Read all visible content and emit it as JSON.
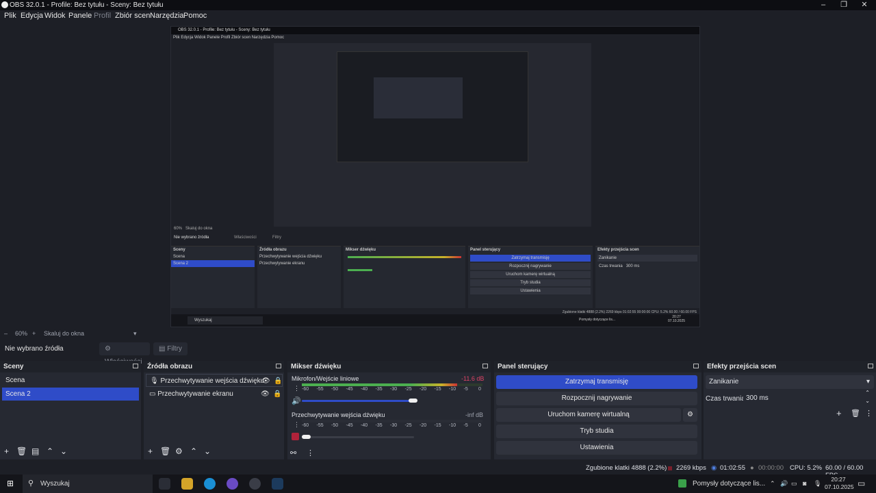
{
  "window": {
    "title": "OBS 32.0.1 - Profile: Bez tytułu - Sceny: Bez tytułu",
    "minimize": "–",
    "maximize": "❐",
    "close": "✕"
  },
  "menu": {
    "items": [
      "Plik",
      "Edycja",
      "Widok",
      "Panele",
      "Profil",
      "Zbiór scen",
      "Narzędzia",
      "Pomoc"
    ]
  },
  "preview": {
    "title": "OBS 32.0.1 - Profile: Bez tytułu - Sceny: Bez tytułu",
    "menu": "Plik  Edycja  Widok  Panele  Profil  Zbiór scen  Narzędzia  Pomoc",
    "zoom": "60%",
    "scale": "Skaluj do okna",
    "no_source": "Nie wybrano źródła",
    "props": "Właściwości",
    "filters": "Filtry",
    "scenes_title": "Sceny",
    "scene1": "Scena",
    "scene2": "Scena 2",
    "sources_title": "Źródła obrazu",
    "source1": "Przechwytywanie wejścia dźwięku",
    "source2": "Przechwytywanie ekranu",
    "mixer_title": "Mikser dźwięku",
    "controls_title": "Panel sterujący",
    "trans_title": "Efekty przejścia scen",
    "btn1": "Zatrzymaj transmisję",
    "btn2": "Rozpocznij nagrywanie",
    "btn3": "Uruchom kamerę wirtualną",
    "btn4": "Tryb studia",
    "btn5": "Ustawienia",
    "fade": "Zanikanie",
    "duration_label": "Czas trwania",
    "duration": "300 ms",
    "task_search": "Wyszukaj",
    "stats": "Zgubione klatki 4888 (2.2%)   2269 kbps   01:02:55   00:00:00   CPU: 5.2%   60.00 / 60.00 FPS",
    "clock_time": "20:27",
    "clock_date": "07.10.2025",
    "tray_text": "Pomysły dotyczące lis..."
  },
  "zoombar": {
    "zoom": "60%",
    "scale_mode": "Skaluj do okna"
  },
  "source_bar": {
    "no_source": "Nie wybrano źródła",
    "properties": "Właściwości",
    "filters": "Filtry"
  },
  "scenes": {
    "title": "Sceny",
    "items": [
      {
        "label": "Scena"
      },
      {
        "label": "Scena 2"
      }
    ]
  },
  "sources": {
    "title": "Źródła obrazu",
    "items": [
      {
        "label": "Przechwytywanie wejścia dźwięku"
      },
      {
        "label": "Przechwytywanie ekranu"
      }
    ]
  },
  "mixer": {
    "title": "Mikser dźwięku",
    "channels": [
      {
        "name": "Mikrofon/Wejście liniowe",
        "level": "-11.6 dB",
        "volume_fraction": 1.0
      },
      {
        "name": "Przechwytywanie wejścia dźwięku",
        "level": "-inf dB",
        "volume_fraction": 0.0
      }
    ],
    "scale": [
      "-60",
      "-55",
      "-50",
      "-45",
      "-40",
      "-35",
      "-30",
      "-25",
      "-20",
      "-15",
      "-10",
      "-5",
      "0"
    ]
  },
  "controls": {
    "title": "Panel sterujący",
    "stop_stream": "Zatrzymaj transmisję",
    "start_record": "Rozpocznij nagrywanie",
    "virtual_cam": "Uruchom kamerę wirtualną",
    "studio_mode": "Tryb studia",
    "settings": "Ustawienia"
  },
  "transitions": {
    "title": "Efekty przejścia scen",
    "selected": "Zanikanie",
    "duration_label": "Czas trwania",
    "duration": "300 ms"
  },
  "status": {
    "dropped": "Zgubione klatki 4888 (2.2%)",
    "bitrate": "2269 kbps",
    "stream_time": "01:02:55",
    "record_time": "00:00:00",
    "cpu": "CPU: 5.2%",
    "fps": "60.00 / 60.00 FPS"
  },
  "taskbar": {
    "search_placeholder": "Wyszukaj",
    "notification": "Pomysły dotyczące lis...",
    "time": "20:27",
    "date": "07.10.2025"
  },
  "colors": {
    "accent": "#2f4cc8",
    "background": "#1d1f26",
    "dock": "#262932"
  }
}
